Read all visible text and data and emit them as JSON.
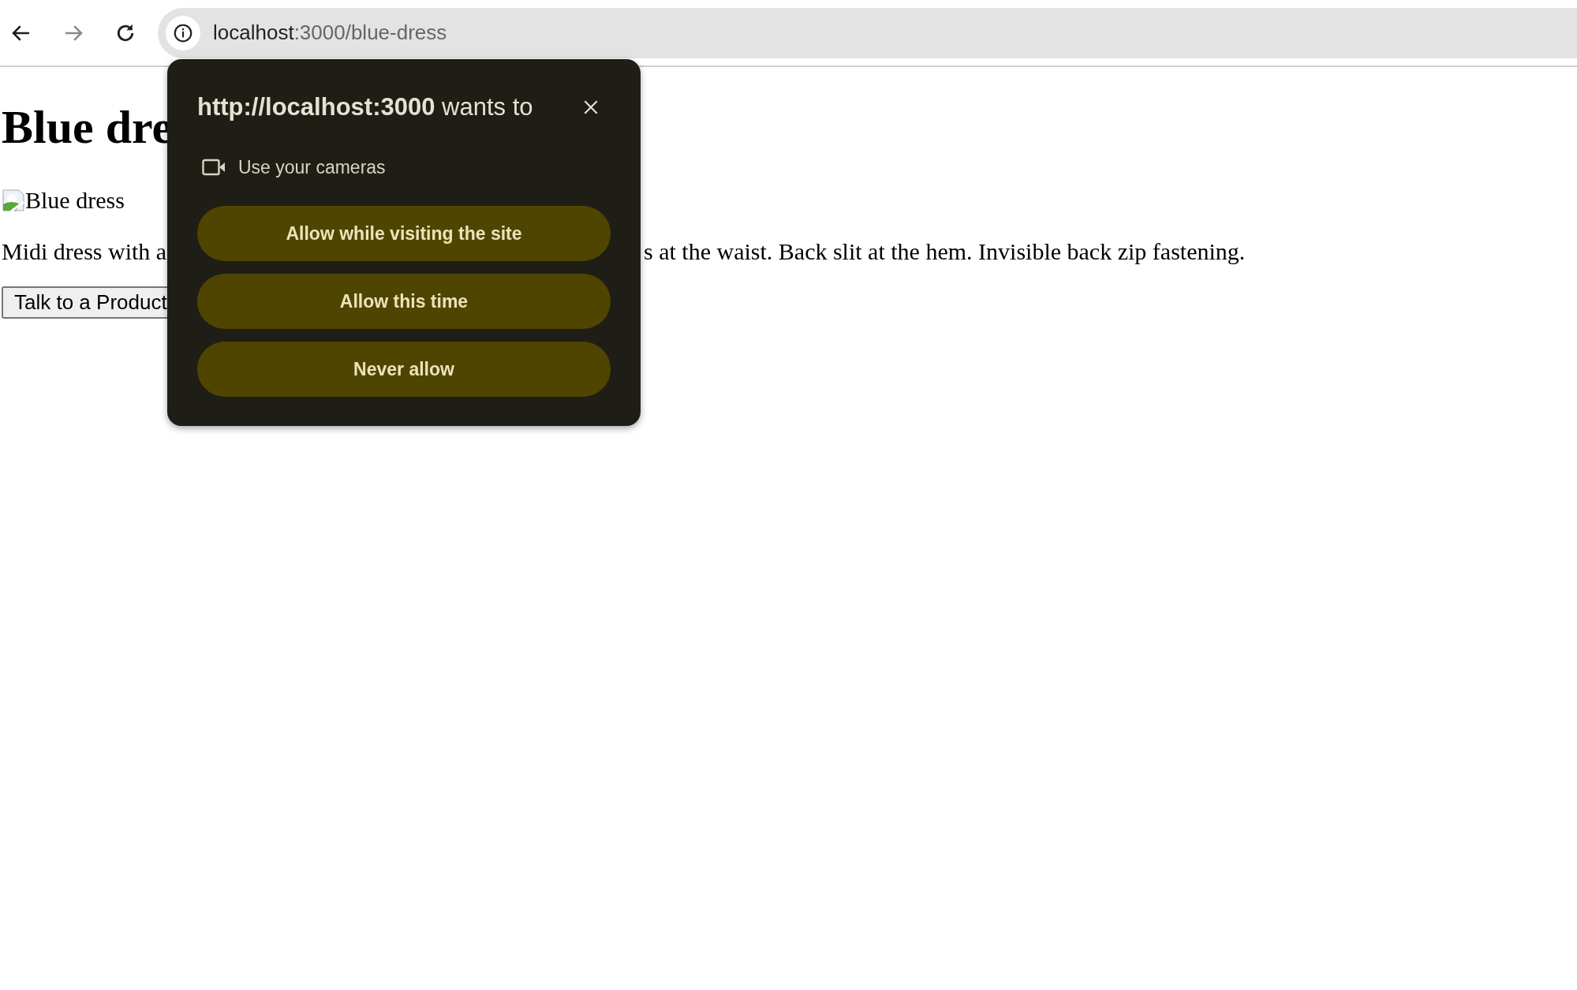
{
  "toolbar": {
    "nav_buttons": [
      {
        "kind": "back",
        "disabled": false
      },
      {
        "kind": "forward",
        "disabled": true
      },
      {
        "kind": "reload",
        "disabled": false
      }
    ],
    "address_bar": {
      "host": "localhost",
      "path": ":3000/blue-dress"
    }
  },
  "page": {
    "heading": "Blue dre",
    "image_alt": "Blue dress",
    "paragraph_parts": [
      "Midi dress with a",
      "s at the waist. Back slit at the hem. Invisible back zip fastening."
    ],
    "button": "Talk to a Product"
  },
  "permission_popup": {
    "title": "**http://localhost:3000** wants to",
    "permission": "Use your cameras",
    "buttons": [
      "Allow while visiting the site",
      "Allow this time",
      "Never allow"
    ]
  }
}
